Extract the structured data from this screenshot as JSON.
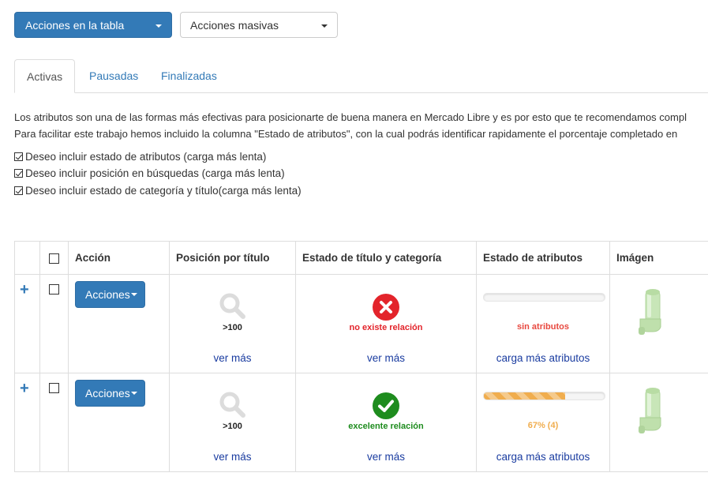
{
  "toolbar": {
    "table_actions_label": "Acciones en la tabla",
    "bulk_actions_label": "Acciones masivas"
  },
  "tabs": [
    {
      "label": "Activas",
      "active": true
    },
    {
      "label": "Pausadas",
      "active": false
    },
    {
      "label": "Finalizadas",
      "active": false
    }
  ],
  "description": {
    "line1": "Los atributos son una de las formas más efectivas para posicionarte de buena manera en Mercado Libre y es por esto que te recomendamos compl",
    "line2": "Para facilitar este trabajo hemos incluido la columna \"Estado de atributos\", con la cual podrás identificar rapidamente el porcentaje completado en"
  },
  "options": [
    {
      "label": "Deseo incluir estado de atributos (carga más lenta)",
      "checked": true
    },
    {
      "label": "Deseo incluir posición en búsquedas (carga más lenta)",
      "checked": true
    },
    {
      "label": "Deseo incluir estado de categoría y título(carga más lenta)",
      "checked": true
    }
  ],
  "table": {
    "headers": [
      "Acción",
      "Posición por título",
      "Estado de título y categoría",
      "Estado de atributos",
      "Imágen"
    ],
    "rows": [
      {
        "action_label": "Acciones",
        "position_value": ">100",
        "position_link": "ver más",
        "category_status": "no existe relación",
        "category_status_color": "#e3242b",
        "category_icon": "x-circle-icon",
        "category_link": "ver más",
        "attributes_text": "sin atributos",
        "attributes_color": "#e8483f",
        "attributes_progress": 0,
        "attributes_link": "carga más atributos"
      },
      {
        "action_label": "Acciones",
        "position_value": ">100",
        "position_link": "ver más",
        "category_status": "excelente relación",
        "category_status_color": "#1e8c1e",
        "category_icon": "check-circle-icon",
        "category_link": "ver más",
        "attributes_text": "67% (4)",
        "attributes_color": "#f0ad4e",
        "attributes_progress": 67,
        "attributes_link": "carga más atributos"
      }
    ]
  },
  "colors": {
    "primary": "#337ab7",
    "link": "#1a3ca0",
    "error": "#e3242b",
    "success": "#1e8c1e",
    "warning": "#f0ad4e"
  }
}
